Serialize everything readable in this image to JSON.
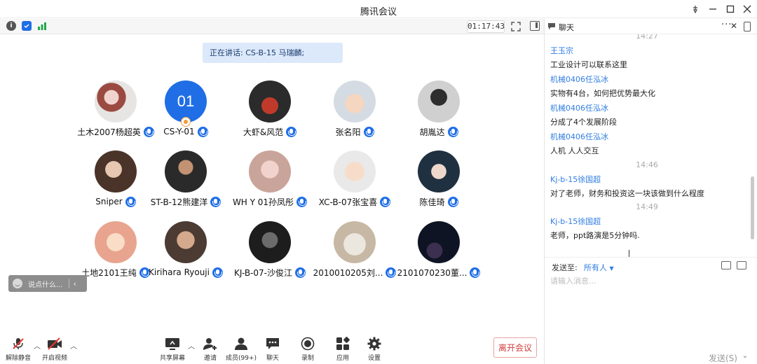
{
  "window": {
    "title": "腾讯会议"
  },
  "infobar": {
    "timer": "01:17:43"
  },
  "speaking": "正在讲话: CS-B-15 马瑞麟;",
  "participants": [
    {
      "name": "土木2007杨超英",
      "avatar": "photo"
    },
    {
      "name": "CS-Y-01",
      "avatar": "initials",
      "initials": "01",
      "host": true
    },
    {
      "name": "大虾&风范",
      "avatar": "photo"
    },
    {
      "name": "张名阳",
      "avatar": "photo"
    },
    {
      "name": "胡胤达",
      "avatar": "photo"
    },
    {
      "name": "Sniper",
      "avatar": "photo"
    },
    {
      "name": "ST-B-12熊建洋",
      "avatar": "photo"
    },
    {
      "name": "WH Y 01孙凤彤",
      "avatar": "photo"
    },
    {
      "name": "XC-B-07张宝喜",
      "avatar": "photo"
    },
    {
      "name": "陈佳琦",
      "avatar": "photo"
    },
    {
      "name": "土地2101王纯",
      "avatar": "photo"
    },
    {
      "name": "Kirihara Ryouji",
      "avatar": "photo"
    },
    {
      "name": "KJ-B-07-沙俊江",
      "avatar": "photo"
    },
    {
      "name": "2010010205刘...",
      "avatar": "photo"
    },
    {
      "name": "2101070230董...",
      "avatar": "photo"
    }
  ],
  "saybox": {
    "placeholder": "说点什么..."
  },
  "toolbar": {
    "mute": "解除静音",
    "video": "开启视频",
    "share": "共享屏幕",
    "invite": "邀请",
    "members": "成员(99+)",
    "chat": "聊天",
    "record": "录制",
    "apps": "应用",
    "settings": "设置",
    "leave": "离开会议"
  },
  "chat": {
    "title": "聊天",
    "messages": [
      {
        "type": "time",
        "text": "14:27"
      },
      {
        "type": "sender",
        "text": "王玉宗"
      },
      {
        "type": "text",
        "text": "工业设计可以联系这里"
      },
      {
        "type": "sender",
        "text": "机械0406任泓冰"
      },
      {
        "type": "text",
        "text": "实物有4台，如何把优势最大化"
      },
      {
        "type": "sender",
        "text": "机械0406任泓冰"
      },
      {
        "type": "text",
        "text": "分成了4个发展阶段"
      },
      {
        "type": "sender",
        "text": "机械0406任泓冰"
      },
      {
        "type": "text",
        "text": "人机 人人交互"
      },
      {
        "type": "time",
        "text": "14:46"
      },
      {
        "type": "sender",
        "text": "Kj-b-15徐国超"
      },
      {
        "type": "text",
        "text": "对了老师，财务和投资这一块该做到什么程度"
      },
      {
        "type": "time",
        "text": "14:49"
      },
      {
        "type": "sender",
        "text": "Kj-b-15徐国超"
      },
      {
        "type": "text",
        "text": "老师，ppt路演是5分钟吗."
      }
    ],
    "send_to_label": "发送至:",
    "send_to_value": "所有人",
    "input_placeholder": "请输入消息...",
    "send_label": "发送(S)"
  },
  "colors": {
    "accent": "#1f6ee6",
    "link": "#2f7de1",
    "leave": "#d43c3c"
  }
}
